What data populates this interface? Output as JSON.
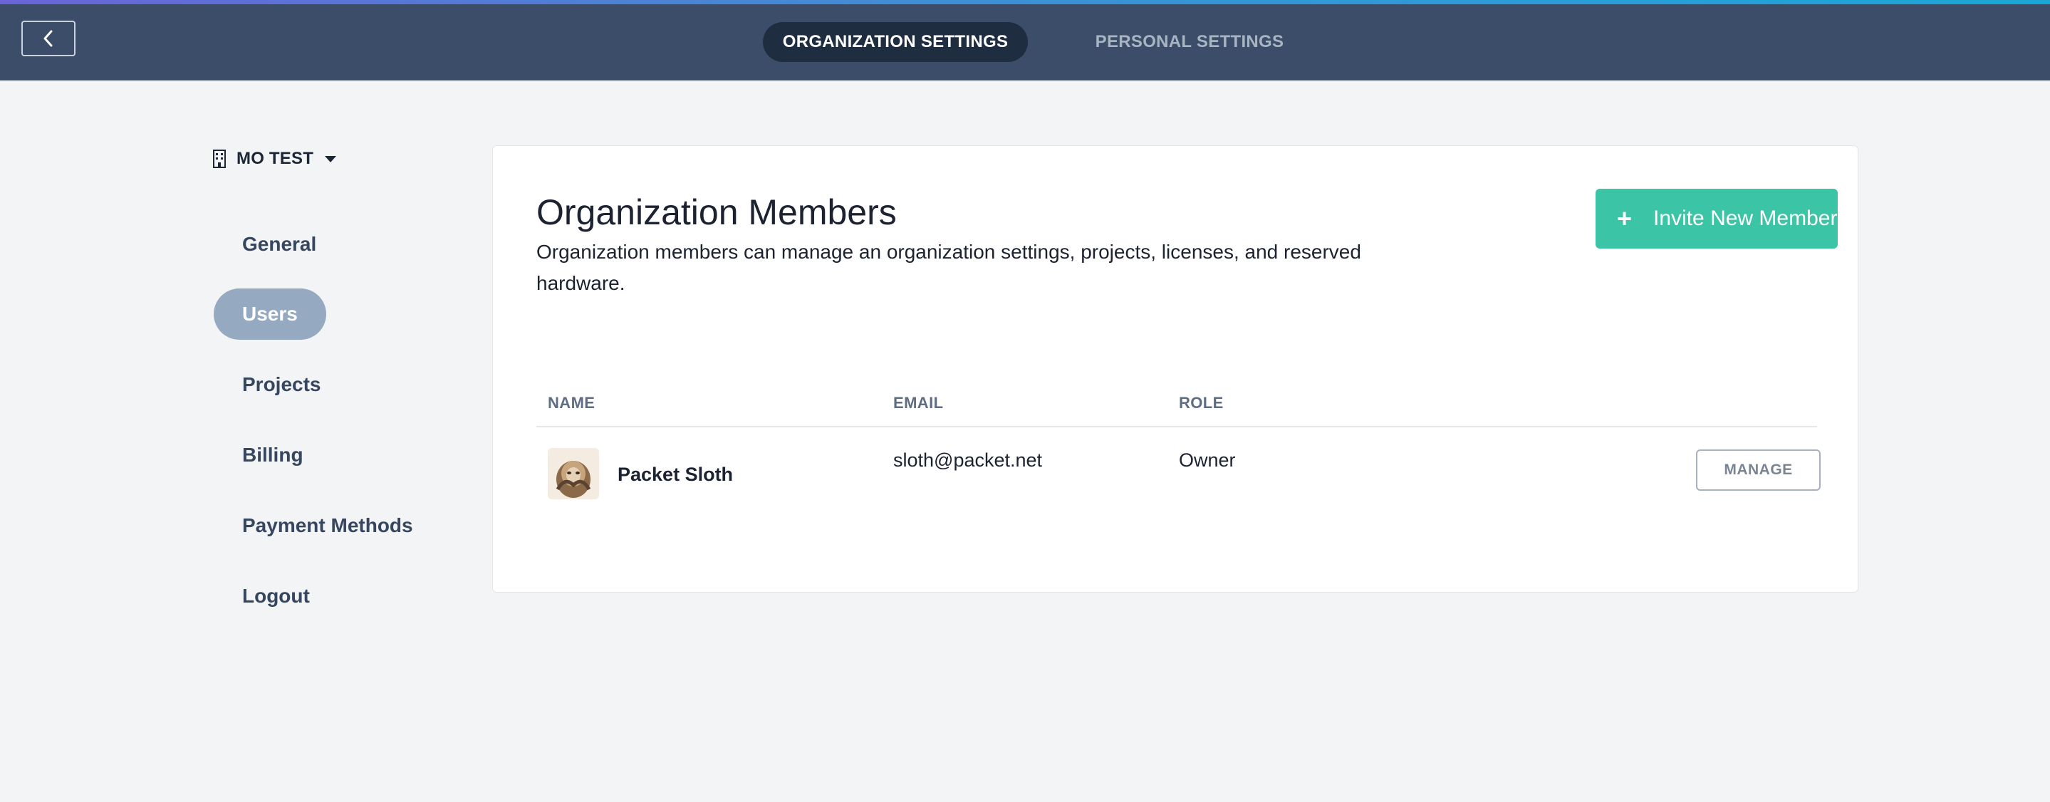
{
  "colors": {
    "header_bg": "#3b4d68",
    "active_tab_bg": "#1f2d40",
    "sidebar_active_bg": "#95a9c0",
    "accent_green": "#3cc4a6",
    "page_bg": "#f3f4f6"
  },
  "header": {
    "back_icon": "chevron-left-icon",
    "tabs": [
      {
        "label": "ORGANIZATION SETTINGS",
        "active": true
      },
      {
        "label": "PERSONAL SETTINGS",
        "active": false
      }
    ]
  },
  "sidebar": {
    "org_icon": "building-icon",
    "org_name": "MO TEST",
    "org_caret_icon": "caret-down-icon",
    "items": [
      {
        "label": "General",
        "active": false
      },
      {
        "label": "Users",
        "active": true
      },
      {
        "label": "Projects",
        "active": false
      },
      {
        "label": "Billing",
        "active": false
      },
      {
        "label": "Payment Methods",
        "active": false
      },
      {
        "label": "Logout",
        "active": false
      }
    ]
  },
  "main": {
    "title": "Organization Members",
    "description": "Organization members can manage an organization settings, projects, licenses, and reserved hardware.",
    "invite_button": {
      "icon": "plus-icon",
      "icon_glyph": "+",
      "label": "Invite New Member"
    },
    "table": {
      "columns": [
        "NAME",
        "EMAIL",
        "ROLE"
      ],
      "rows": [
        {
          "name": "Packet Sloth",
          "email": "sloth@packet.net",
          "role": "Owner",
          "action": "MANAGE"
        }
      ]
    }
  }
}
